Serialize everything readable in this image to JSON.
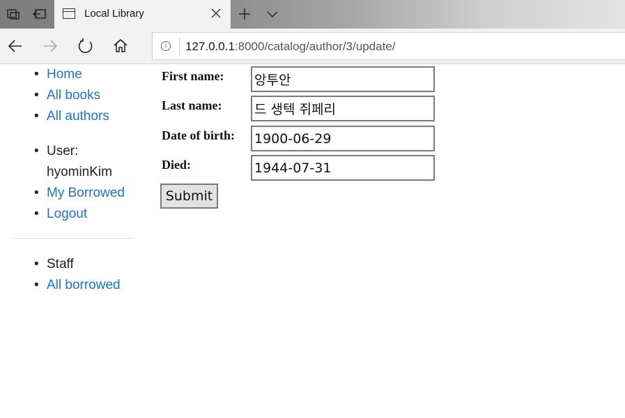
{
  "browser": {
    "tab_title": "Local Library",
    "url_host": "127.0.0.1",
    "url_rest": ":8000/catalog/author/3/update/"
  },
  "sidebar": {
    "nav": [
      {
        "label": "Home"
      },
      {
        "label": "All books"
      },
      {
        "label": "All authors"
      }
    ],
    "user_label": "User:",
    "username": "hyominKim",
    "user_links": [
      {
        "label": "My Borrowed"
      },
      {
        "label": "Logout"
      }
    ],
    "staff_label": "Staff",
    "staff_links": [
      {
        "label": "All borrowed"
      }
    ]
  },
  "form": {
    "first_name_label": "First name:",
    "first_name_value": "앙투안",
    "last_name_label": "Last name:",
    "last_name_value": "드 생텍 쥐페리",
    "dob_label": "Date of birth:",
    "dob_value": "1900-06-29",
    "died_label": "Died:",
    "died_value": "1944-07-31",
    "submit_label": "Submit"
  },
  "colors": {
    "link": "#1a73d8",
    "tab_active": "#f2f2f2"
  }
}
